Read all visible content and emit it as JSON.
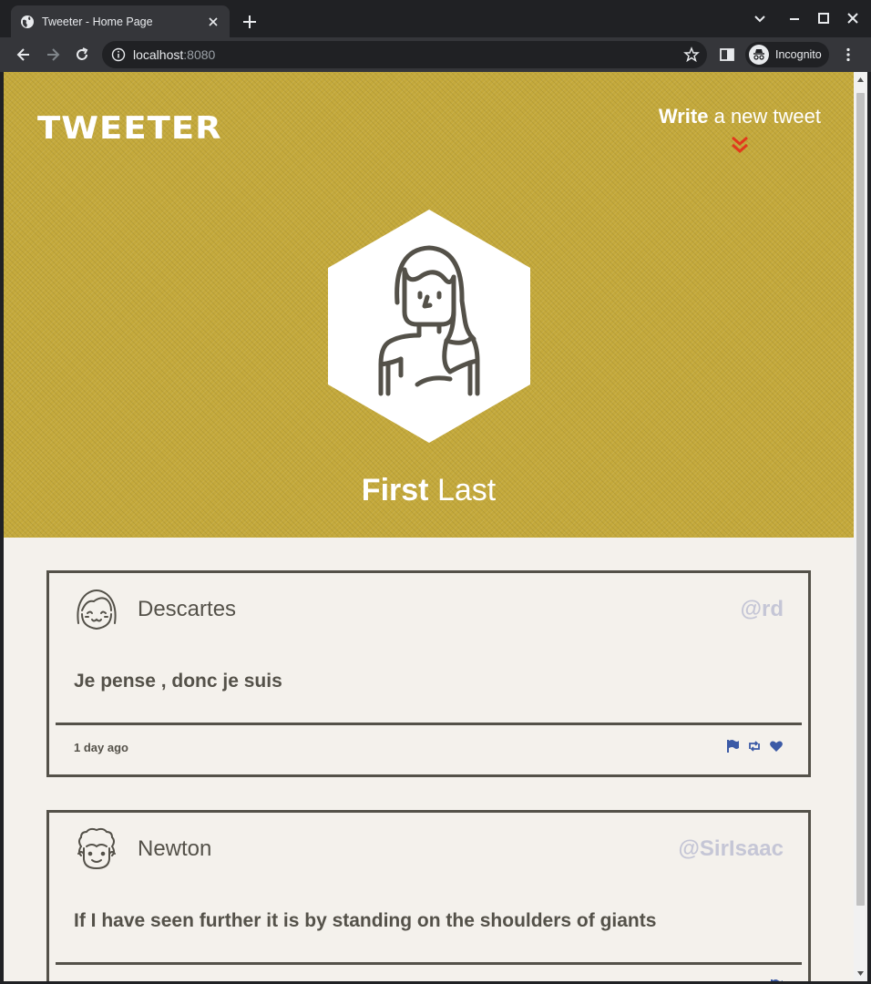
{
  "browser": {
    "tab_title": "Tweeter - Home Page",
    "url_host": "localhost",
    "url_port": ":8080",
    "incognito_label": "Incognito"
  },
  "header": {
    "logo": "TWEETER",
    "compose_bold": "Write",
    "compose_rest": " a new tweet"
  },
  "profile": {
    "first_name": "First",
    "last_name": "Last"
  },
  "tweets": [
    {
      "name": "Descartes",
      "handle": "@rd",
      "body": "Je pense , donc je suis",
      "time": "1 day ago"
    },
    {
      "name": "Newton",
      "handle": "@SirIsaac",
      "body": "If I have seen further it is by standing on the shoulders of giants",
      "time": ""
    }
  ],
  "colors": {
    "hero": "#c4a93b",
    "ink": "#545149",
    "handle": "#c5c6d6",
    "accent_red": "#e2381c",
    "action_blue": "#3b5aa6"
  }
}
